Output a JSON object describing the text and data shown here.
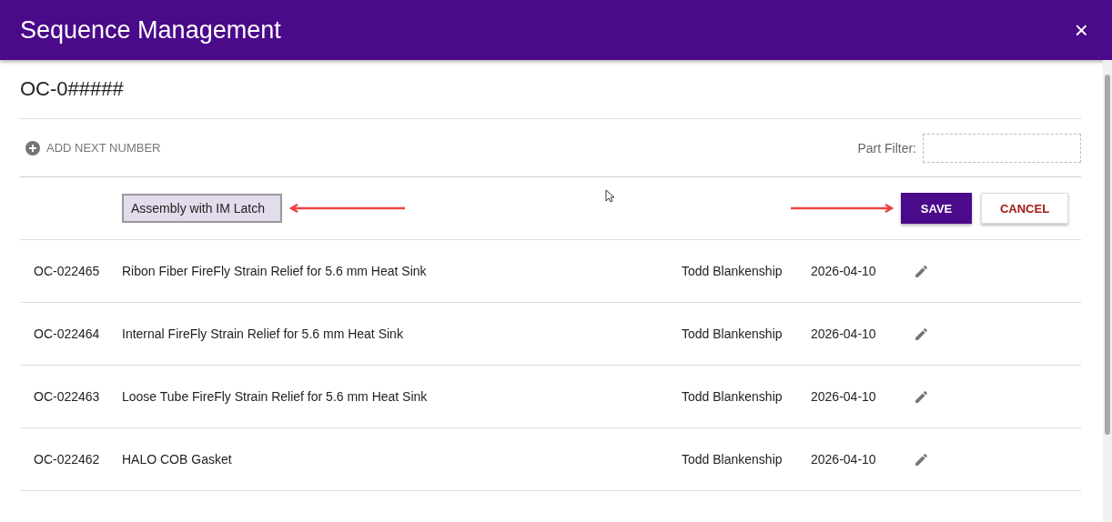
{
  "window": {
    "title": "Sequence Management",
    "close": "×"
  },
  "sequence": {
    "title": "OC-0#####"
  },
  "toolbar": {
    "add_label": "ADD NEXT NUMBER",
    "filter_label": "Part Filter:"
  },
  "edit_row": {
    "value": "Assembly with IM Latch",
    "save": "SAVE",
    "cancel": "CANCEL"
  },
  "rows": [
    {
      "number": "OC-022465",
      "description": "Ribon Fiber FireFly Strain Relief for 5.6 mm Heat Sink",
      "owner": "Todd Blankenship",
      "date": "2026-04-10"
    },
    {
      "number": "OC-022464",
      "description": "Internal FireFly Strain Relief for 5.6 mm Heat Sink",
      "owner": "Todd Blankenship",
      "date": "2026-04-10"
    },
    {
      "number": "OC-022463",
      "description": "Loose Tube FireFly Strain Relief for 5.6 mm Heat Sink",
      "owner": "Todd Blankenship",
      "date": "2026-04-10"
    },
    {
      "number": "OC-022462",
      "description": "HALO COB Gasket",
      "owner": "Todd Blankenship",
      "date": "2026-04-10"
    }
  ]
}
